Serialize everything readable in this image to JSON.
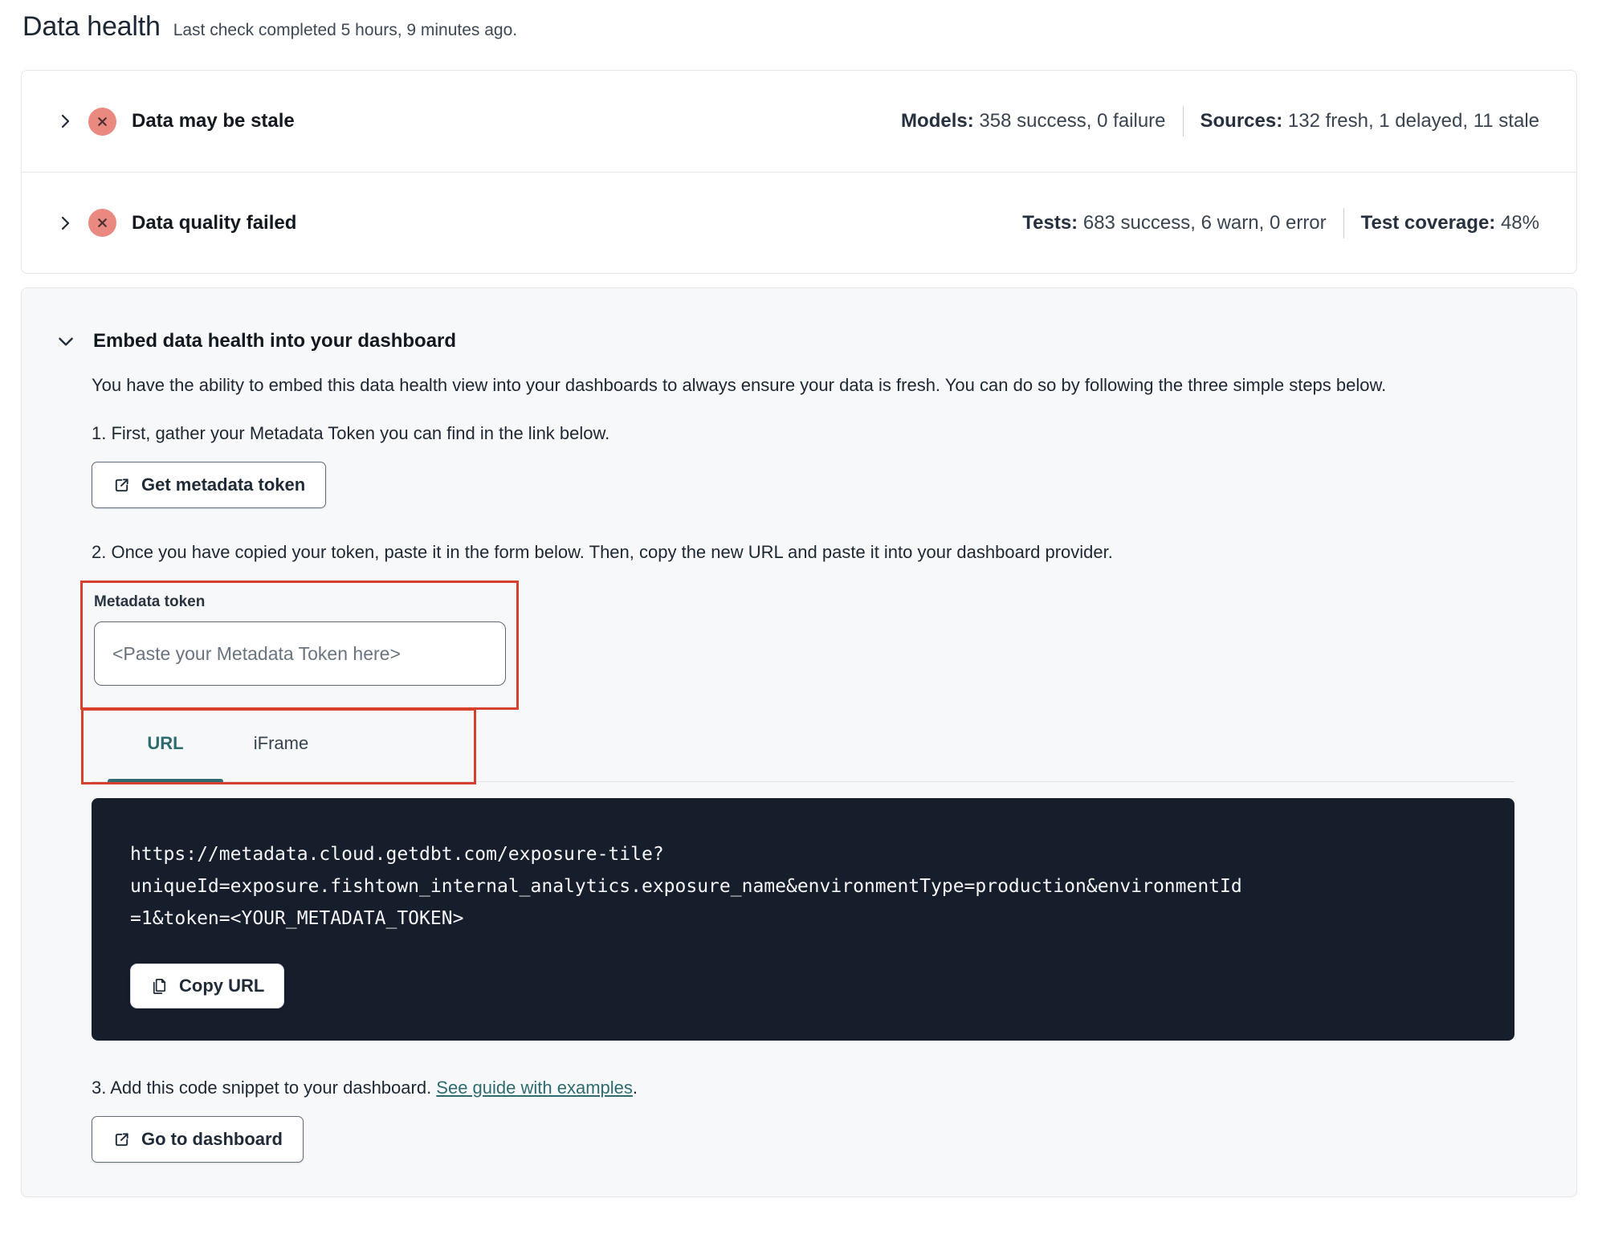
{
  "page": {
    "title": "Data health",
    "subtitle": "Last check completed 5 hours, 9 minutes ago."
  },
  "status_rows": [
    {
      "label": "Data may be stale",
      "status": "error",
      "stats": [
        {
          "label": "Models:",
          "value": "358 success, 0 failure"
        },
        {
          "label": "Sources:",
          "value": "132 fresh, 1 delayed, 11 stale"
        }
      ]
    },
    {
      "label": "Data quality failed",
      "status": "error",
      "stats": [
        {
          "label": "Tests:",
          "value": "683 success, 6 warn, 0 error"
        },
        {
          "label": "Test coverage:",
          "value": "48%"
        }
      ]
    }
  ],
  "embed": {
    "heading": "Embed data health into your dashboard",
    "description": "You have the ability to embed this data health view into your dashboards to always ensure your data is fresh. You can do so by following the three simple steps below.",
    "step1": "1. First, gather your Metadata Token you can find in the link below.",
    "get_token_button": "Get metadata token",
    "step2": "2. Once you have copied your token, paste it in the form below. Then, copy the new URL and paste it into your dashboard provider.",
    "token_field": {
      "label": "Metadata token",
      "placeholder": "<Paste your Metadata Token here>"
    },
    "tabs": [
      {
        "label": "URL",
        "active": true
      },
      {
        "label": "iFrame",
        "active": false
      }
    ],
    "code_url": "https://metadata.cloud.getdbt.com/exposure-tile?uniqueId=exposure.fishtown_internal_analytics.exposure_name&environmentType=production&environmentId=1&token=<YOUR_METADATA_TOKEN>",
    "code_lines": [
      "https://metadata.cloud.getdbt.com/exposure-tile?",
      "uniqueId=exposure.fishtown_internal_analytics.exposure_name&environmentType=production&environmentId",
      "=1&token=<YOUR_METADATA_TOKEN>"
    ],
    "copy_button": "Copy URL",
    "step3_prefix": "3. Add this code snippet to your dashboard. ",
    "step3_link": "See guide with examples",
    "step3_suffix": ".",
    "dashboard_button": "Go to dashboard"
  },
  "colors": {
    "accent_teal": "#2e6b70",
    "error_badge": "#e98980",
    "error_badge_glyph": "#4d2f31",
    "annotation_red": "#d5402f",
    "code_background": "#161d2b",
    "panel_background": "#f7f8f9"
  }
}
